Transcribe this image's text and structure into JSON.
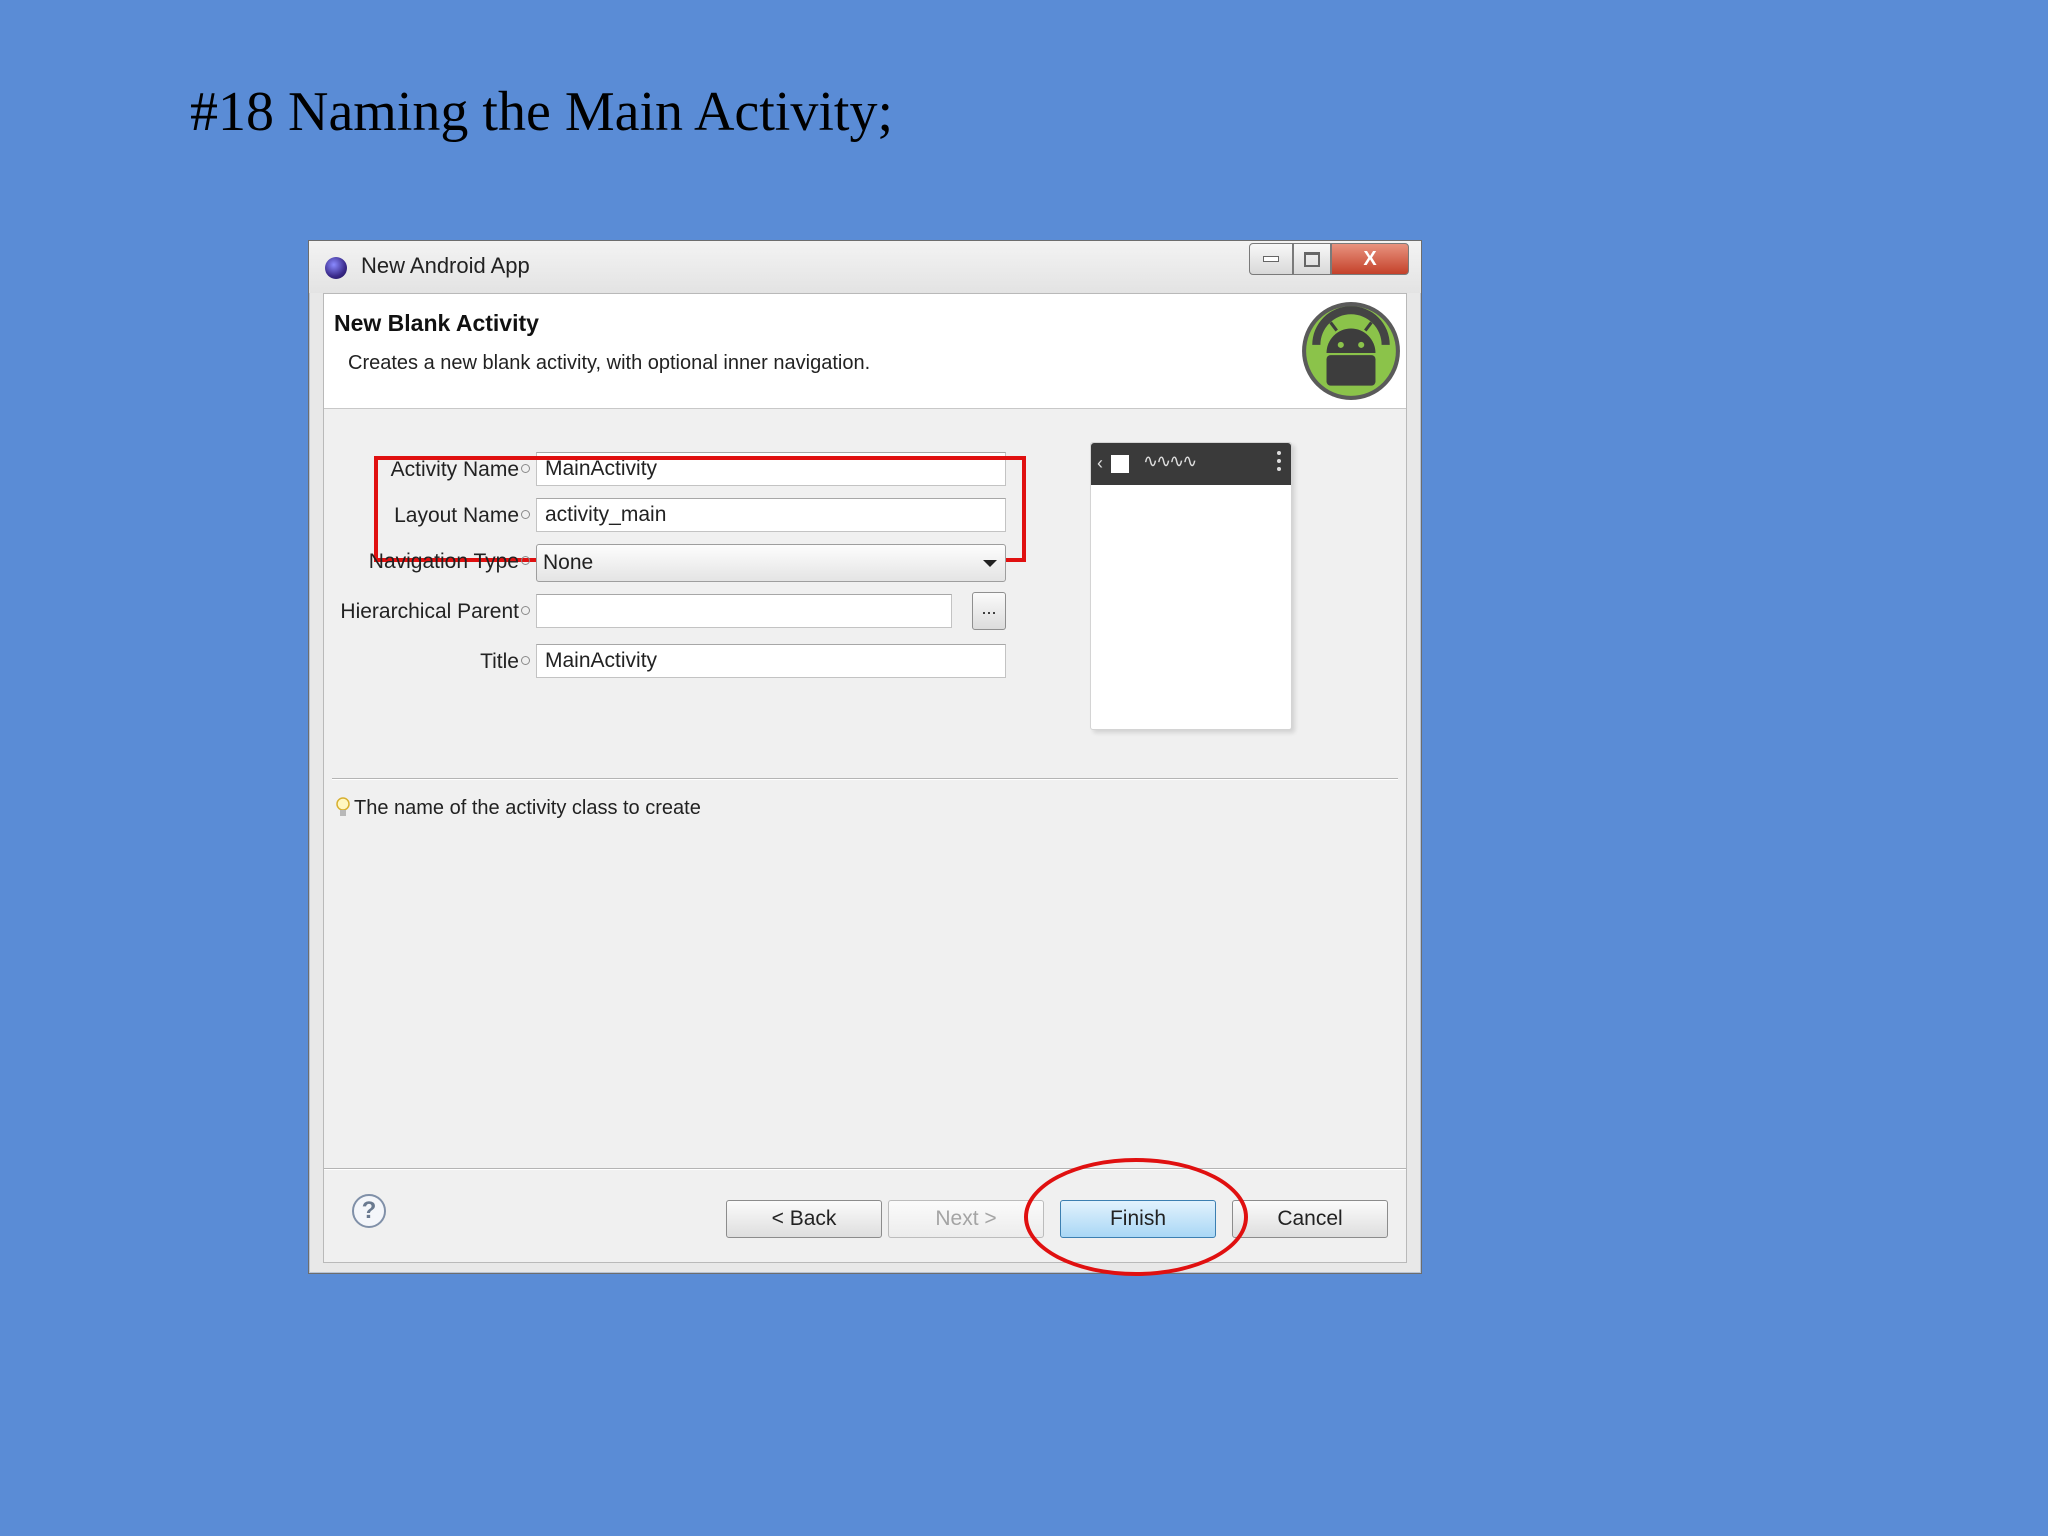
{
  "slide": {
    "title": "#18 Naming the Main Activity;"
  },
  "window": {
    "title": "New Android App",
    "close_glyph": "X"
  },
  "header": {
    "title": "New Blank Activity",
    "description": "Creates a new blank activity, with optional inner navigation."
  },
  "form": {
    "activity_name": {
      "label": "Activity Name",
      "value": "MainActivity"
    },
    "layout_name": {
      "label": "Layout Name",
      "value": "activity_main"
    },
    "navigation_type": {
      "label": "Navigation Type",
      "value": "None"
    },
    "hierarchical_parent": {
      "label": "Hierarchical Parent",
      "value": "",
      "browse_label": "..."
    },
    "title": {
      "label": "Title",
      "value": "MainActivity"
    }
  },
  "hint": "The name of the activity class to create",
  "footer": {
    "help_glyph": "?",
    "back_label": "< Back",
    "next_label": "Next >",
    "finish_label": "Finish",
    "cancel_label": "Cancel"
  },
  "annotations": {
    "highlight_color": "#e01010"
  }
}
